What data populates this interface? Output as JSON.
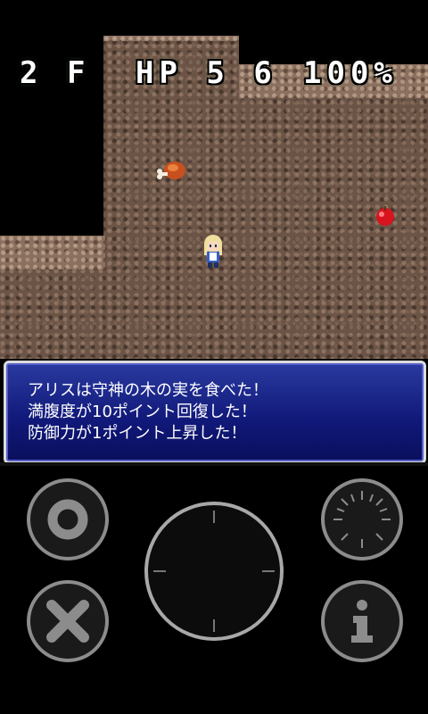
{
  "hud": {
    "floor": "2 F",
    "hp": "HP 5 6",
    "fullness": "100%"
  },
  "message": {
    "line1": "アリスは守神の木の実を食べた！",
    "line2": "満腹度が10ポイント回復した！",
    "line3": "防御力が1ポイント上昇した！"
  },
  "sprites": {
    "item_meat": "meat-icon",
    "item_apple": "apple-icon",
    "player": "alice-character"
  },
  "controls": {
    "circle_button": "circle-icon",
    "cross_button": "cross-icon",
    "direction_pad": "dpad-icon",
    "wait_button": "clock-icon",
    "info_button": "info-icon"
  },
  "colors": {
    "message_bg": "#101878",
    "message_border": "#dcdcdc",
    "floor_rock": "#6b5446",
    "button_ring": "#8c8c8c"
  }
}
